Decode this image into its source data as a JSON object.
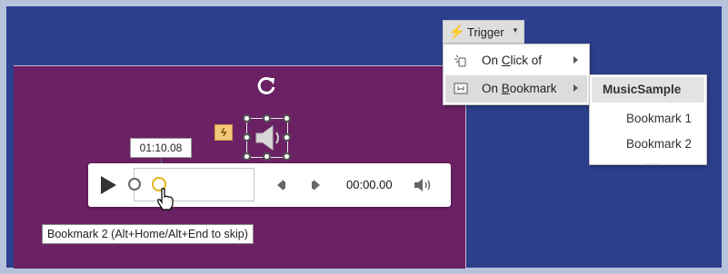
{
  "ribbon": {
    "trigger_label": "Trigger"
  },
  "trigger_menu": {
    "items": [
      {
        "prefix": "On ",
        "accel": "C",
        "rest": "lick of",
        "icon": "click-of-icon"
      },
      {
        "prefix": "On ",
        "accel": "B",
        "rest": "ookmark",
        "icon": "bookmark-icon"
      }
    ]
  },
  "bookmark_submenu": {
    "header": "MusicSample",
    "items": [
      "Bookmark 1",
      "Bookmark 2"
    ],
    "grip": "....."
  },
  "player": {
    "hover_time": "01:10.08",
    "elapsed": "00:00.00",
    "bookmark_tooltip": "Bookmark 2 (Alt+Home/Alt+End to skip)"
  },
  "colors": {
    "background": "#2c3f8c",
    "slide": "#6a2264",
    "bookmark_active": "#e4b41c",
    "trigger_icon": "#e8a92b"
  }
}
